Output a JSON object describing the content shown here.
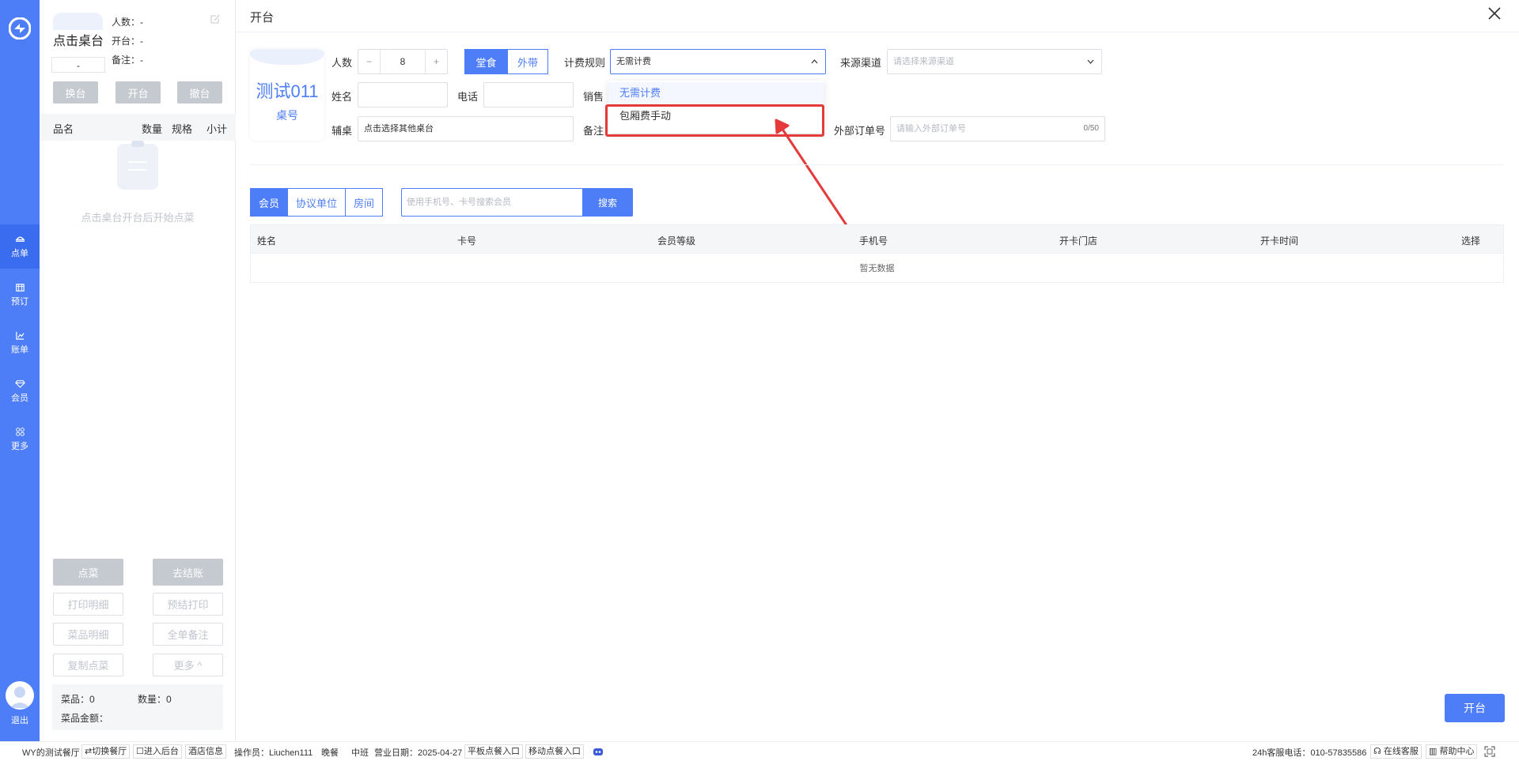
{
  "nav": {
    "items": [
      {
        "label": "点单",
        "icon": "order-icon"
      },
      {
        "label": "预订",
        "icon": "reserve-icon"
      },
      {
        "label": "账单",
        "icon": "bill-chart-icon"
      },
      {
        "label": "会员",
        "icon": "diamond-icon"
      },
      {
        "label": "更多",
        "icon": "grid-icon"
      }
    ],
    "exit_label": "退出"
  },
  "order_panel": {
    "table_title": "点击桌台",
    "table_number": "-",
    "meta": {
      "people": "人数：-",
      "open": "开台：-",
      "remark": "备注：-"
    },
    "buttons": {
      "change": "换台",
      "open": "开台",
      "cancel": "撤台"
    },
    "columns": {
      "name": "品名",
      "qty": "数量",
      "spec": "规格",
      "subtotal": "小计"
    },
    "empty_text": "点击桌台开台后开始点菜",
    "actions": {
      "order": "点菜",
      "checkout": "去结账",
      "print_detail": "打印明细",
      "pre_print": "预结打印",
      "dish_detail": "菜品明细",
      "order_remark": "全单备注",
      "copy_order": "复制点菜",
      "more": "更多 ^"
    },
    "summary": {
      "dishes": "菜品：0",
      "count": "数量：0",
      "amount": "菜品金额："
    }
  },
  "dialog": {
    "title": "开台",
    "table_card": {
      "name": "测试011",
      "label": "桌号"
    },
    "people": {
      "label": "人数",
      "minus": "−",
      "value": "8",
      "plus": "+"
    },
    "dine_mode": {
      "dine_in": "堂食",
      "takeaway": "外带"
    },
    "billing_rule": {
      "label": "计费规则",
      "value": "无需计费",
      "options": [
        "无需计费",
        "包厢费手动"
      ]
    },
    "source_channel": {
      "label": "来源渠道",
      "placeholder": "请选择来源渠道"
    },
    "name": {
      "label": "姓名",
      "value": ""
    },
    "phone": {
      "label": "电话",
      "value": ""
    },
    "sales": {
      "label": "销售"
    },
    "aux_table": {
      "label": "辅桌",
      "value": "点击选择其他桌台"
    },
    "remark": {
      "label": "备注"
    },
    "external_order": {
      "label": "外部订单号",
      "placeholder": "请输入外部订单号",
      "counter": "0/50"
    },
    "tabs": {
      "member": "会员",
      "agreement": "协议单位",
      "room": "房间"
    },
    "search": {
      "placeholder": "使用手机号、卡号搜索会员",
      "button": "搜索"
    },
    "table": {
      "columns": [
        "姓名",
        "卡号",
        "会员等级",
        "手机号",
        "开卡门店",
        "开卡时间",
        "选择"
      ],
      "empty": "暂无数据"
    },
    "open_button": "开台"
  },
  "footer": {
    "restaurant": "WY的测试餐厅",
    "switch": "⇄切换餐厅",
    "backend": "☐进入后台",
    "hotel_info": "酒店信息",
    "operator": "操作员：Liuchen111",
    "meal": "晚餐",
    "shift": "中班",
    "business_date": "营业日期：2025-04-27",
    "tablet_entry": "平板点餐入口",
    "mobile_entry": "移动点餐入口",
    "hotline": "24h客服电话：010-57835586",
    "online_service": "在线客服",
    "help_center": "帮助中心"
  },
  "colors": {
    "accent": "#4d7ef7",
    "highlight": "#e43a3a"
  }
}
